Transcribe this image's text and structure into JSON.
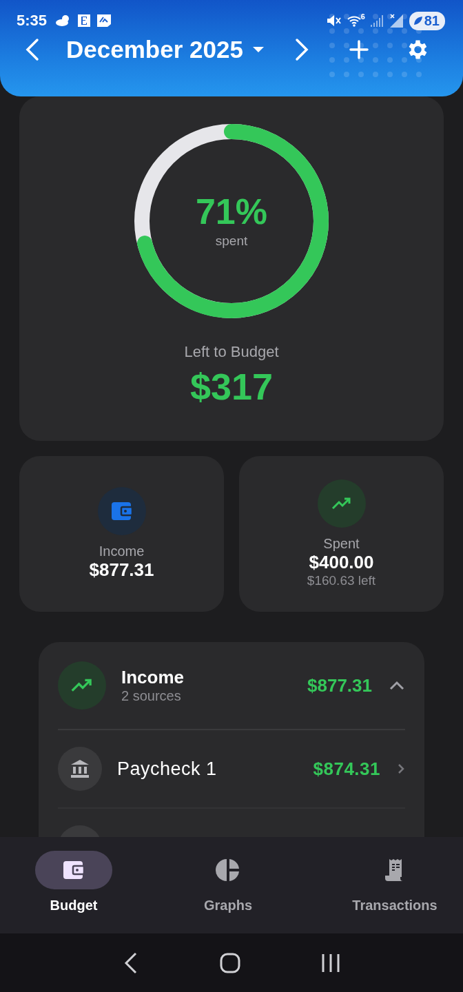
{
  "status_bar": {
    "time": "5:35",
    "wifi_badge": "6",
    "battery": "81"
  },
  "header": {
    "month": "December 2025"
  },
  "summary": {
    "level": 0.71,
    "percent": "71%",
    "percent_label": "spent",
    "left_label": "Left to Budget",
    "left_amount": "$317"
  },
  "stats": [
    {
      "kind": "income",
      "label": "Income",
      "amount": "$877.31"
    },
    {
      "kind": "spent",
      "label": "Spent",
      "amount": "$400.00",
      "note": "$160.63 left"
    }
  ],
  "income_group": {
    "title": "Income",
    "subtitle": "2 sources",
    "total": "$877.31",
    "expanded": true,
    "items": [
      {
        "name": "Paycheck 1",
        "amount": "$874.31"
      }
    ]
  },
  "nav": [
    {
      "label": "Budget",
      "selected": true
    },
    {
      "label": "Graphs",
      "selected": false
    },
    {
      "label": "Transactions",
      "selected": false
    }
  ]
}
